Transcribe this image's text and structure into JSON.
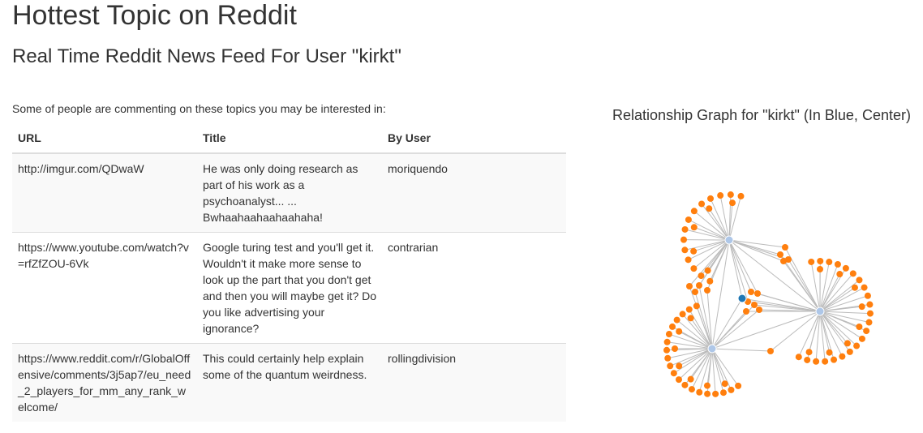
{
  "page": {
    "title": "Hottest Topic on Reddit",
    "subtitle": "Real Time Reddit News Feed For User \"kirkt\"",
    "intro": "Some of people are commenting on these topics you may be interested in:"
  },
  "table": {
    "headers": {
      "url": "URL",
      "title": "Title",
      "user": "By User"
    },
    "rows": [
      {
        "url": "http://imgur.com/QDwaW",
        "title": "He was only doing research as part of his work as a psychoanalyst... ... Bwhaahaahaahaahaha!",
        "user": "moriquendo"
      },
      {
        "url": "https://www.youtube.com/watch?v=rfZfZOU-6Vk",
        "title": "Google turing test and you'll get it. Wouldn't it make more sense to look up the part that you don't get and then you will maybe get it? Do you like advertising your ignorance?",
        "user": "contrarian"
      },
      {
        "url": "https://www.reddit.com/r/GlobalOffensive/comments/3j5ap7/eu_need_2_players_for_mm_any_rank_welcome/",
        "title": "This could certainly help explain some of the quantum weirdness.",
        "user": "rollingdivision"
      }
    ]
  },
  "graph": {
    "title": "Relationship Graph for \"kirkt\" (In Blue, Center)",
    "colors": {
      "center": "#1f77b4",
      "hub": "#aec7e8",
      "leaf": "#ff7f0e",
      "link": "#bbbbbb"
    }
  }
}
